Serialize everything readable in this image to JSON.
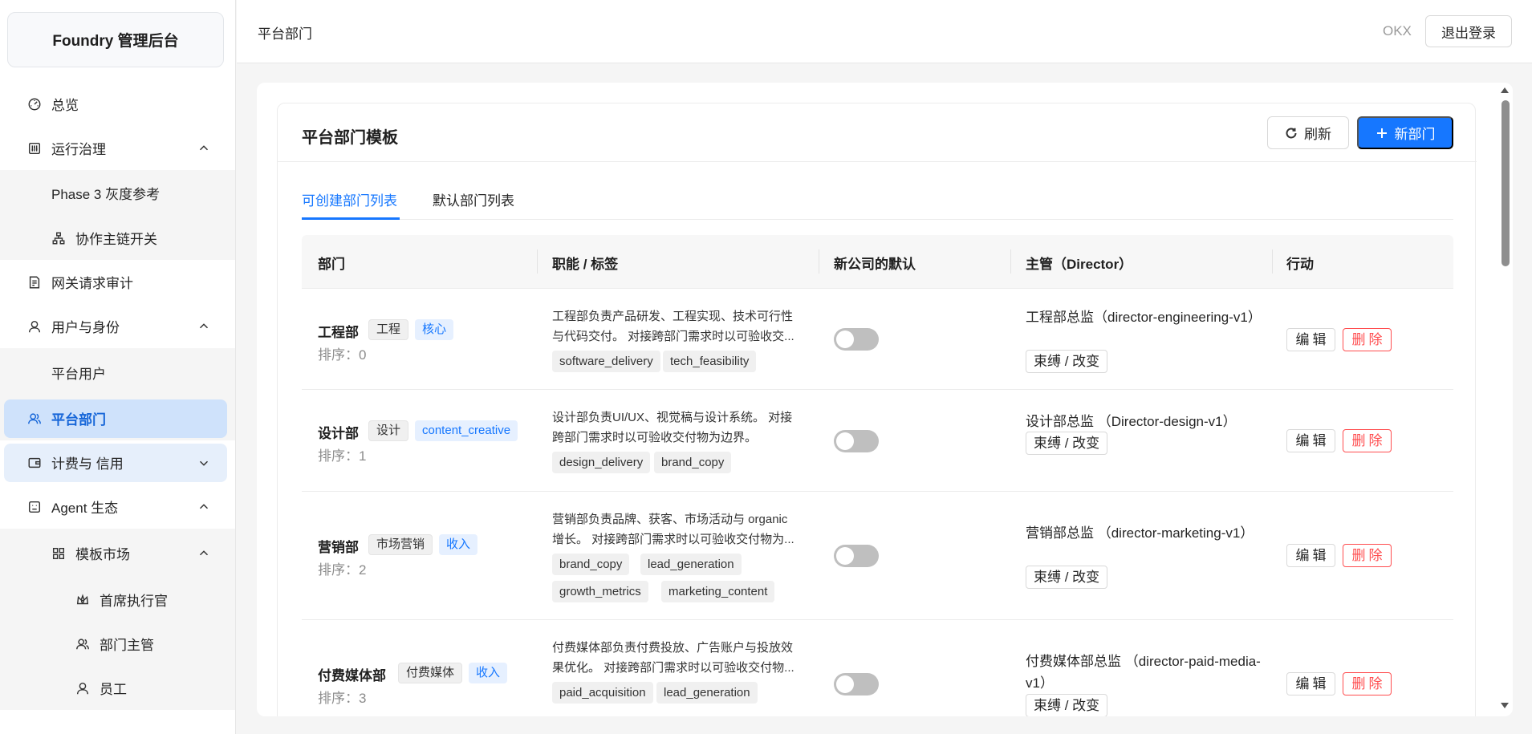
{
  "app": {
    "title": "Foundry 管理后台"
  },
  "sidebar": {
    "items": [
      {
        "label": "总览",
        "icon": "dashboard-icon"
      },
      {
        "label": "运行治理",
        "icon": "sliders-icon",
        "expanded": true
      },
      {
        "label": "Phase 3 灰度参考"
      },
      {
        "label": "协作主链开关",
        "icon": "sitemap-icon"
      },
      {
        "label": "网关请求审计",
        "icon": "audit-icon"
      },
      {
        "label": "用户与身份",
        "icon": "user-icon",
        "expanded": true
      },
      {
        "label": "平台用户"
      },
      {
        "label": "平台部门",
        "icon": "team-icon",
        "active": true
      },
      {
        "label": "计费与 信用",
        "icon": "wallet-icon",
        "expanded": false
      },
      {
        "label": "Agent 生态",
        "icon": "robot-icon",
        "expanded": true
      },
      {
        "label": "模板市场",
        "icon": "grid-icon",
        "expanded": true
      },
      {
        "label": "首席执行官",
        "icon": "crown-icon"
      },
      {
        "label": "部门主管",
        "icon": "team-icon"
      },
      {
        "label": "员工",
        "icon": "user-icon"
      }
    ]
  },
  "header": {
    "breadcrumb": "平台部门",
    "user": "OKX",
    "logout_label": "退出登录"
  },
  "main": {
    "title": "平台部门模板",
    "refresh_label": "刷新",
    "new_label": "新部门",
    "tabs": [
      {
        "label": "可创建部门列表",
        "active": true
      },
      {
        "label": "默认部门列表",
        "active": false
      }
    ],
    "columns": [
      "部门",
      "职能 / 标签",
      "新公司的默认",
      "主管（Director）",
      "行动"
    ],
    "rows": [
      {
        "name": "工程部",
        "tags": [
          "工程",
          "核心"
        ],
        "order": "排序：0",
        "desc": "工程部负责产品研发、工程实现、技术可行性与代码交付。 对接跨部门需求时以可验收交...",
        "functions": [
          "software_delivery",
          "tech_feasibility"
        ],
        "default_on": false,
        "director": "工程部总监（director-engineering-v1）",
        "bind_label": "束缚 / 改变",
        "edit_label": "编辑",
        "delete_label": "删除"
      },
      {
        "name": "设计部",
        "tags": [
          "设计",
          "content_creative"
        ],
        "order": "排序：1",
        "desc": "设计部负责UI/UX、视觉稿与设计系统。 对接跨部门需求时以可验收交付物为边界。",
        "functions": [
          "design_delivery",
          "brand_copy"
        ],
        "default_on": false,
        "director": "设计部总监 （Director-design-v1）",
        "bind_label": "束缚 / 改变",
        "edit_label": "编辑",
        "delete_label": "删除"
      },
      {
        "name": "营销部",
        "tags": [
          "市场营销",
          "收入"
        ],
        "order": "排序：2",
        "desc": "营销部负责品牌、获客、市场活动与 organic 增长。 对接跨部门需求时以可验收交付物为...",
        "functions": [
          "brand_copy",
          "lead_generation",
          "growth_metrics",
          "marketing_content"
        ],
        "default_on": false,
        "director": "营销部总监 （director-marketing-v1）",
        "bind_label": "束缚 / 改变",
        "edit_label": "编辑",
        "delete_label": "删除"
      },
      {
        "name": "付费媒体部",
        "tags": [
          "付费媒体",
          "收入"
        ],
        "order": "排序：3",
        "desc": "付费媒体部负责付费投放、广告账户与投放效果优化。 对接跨部门需求时以可验收交付物...",
        "functions": [
          "paid_acquisition",
          "lead_generation"
        ],
        "default_on": false,
        "director": "付费媒体部总监 （director-paid-media-v1）",
        "bind_label": "束缚 / 改变",
        "edit_label": "编辑",
        "delete_label": "删除"
      }
    ]
  },
  "colors": {
    "primary": "#1677ff",
    "danger": "#ff4d4f",
    "active_nav_bg": "#cfe2fb",
    "toggle_off": "#bfbfbf"
  }
}
